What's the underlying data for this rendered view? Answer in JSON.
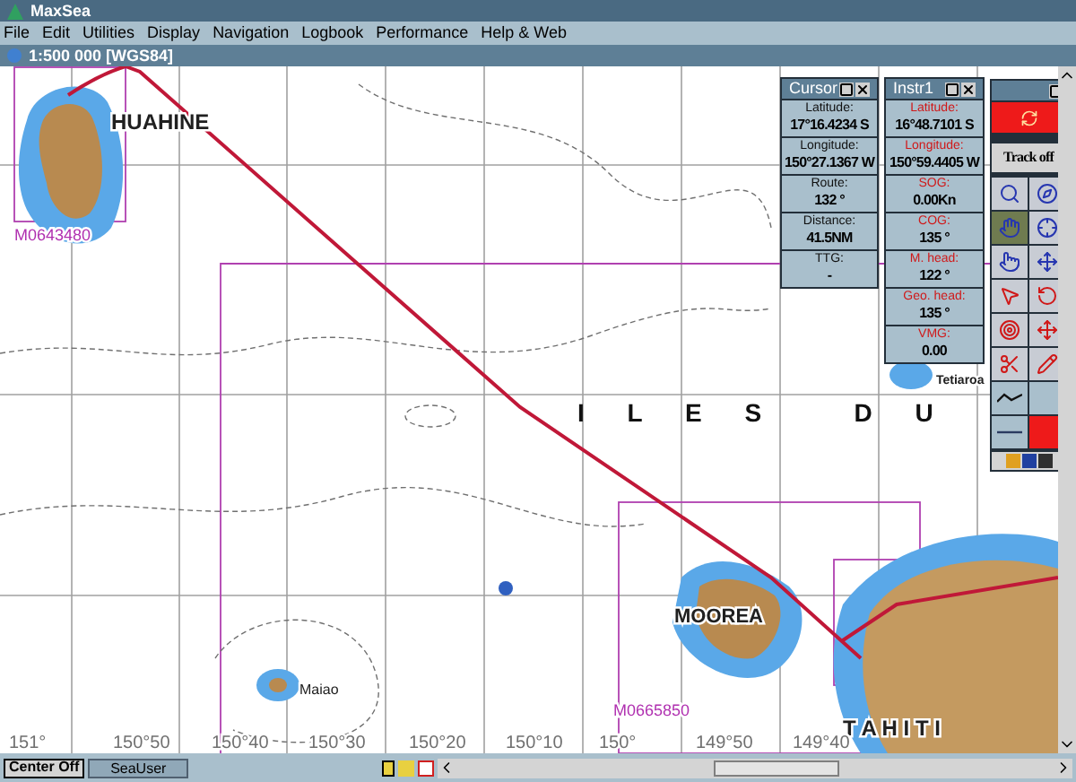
{
  "window": {
    "title": "MaxSea"
  },
  "menu": [
    "File",
    "Edit",
    "Utilities",
    "Display",
    "Navigation",
    "Logbook",
    "Performance",
    "Help & Web"
  ],
  "chart_window": {
    "title": "1:500 000 [WGS84]"
  },
  "map": {
    "islands": [
      "HUAHINE",
      "MOOREA",
      "T A H I T I",
      "Maiao",
      "Tetiaroa"
    ],
    "region": "I L E S   D U",
    "chart_codes": [
      "M0643480",
      "M0665850"
    ],
    "longitudes": [
      "151°",
      "150°50",
      "150°40",
      "150°30",
      "150°20",
      "150°10",
      "150°",
      "149°50",
      "149°40"
    ]
  },
  "cursor_panel": {
    "title": "Cursor",
    "fields": [
      {
        "label": "Latitude:",
        "value": "17°16.4234 S"
      },
      {
        "label": "Longitude:",
        "value": "150°27.1367 W"
      },
      {
        "label": "Route:",
        "value": "132 °"
      },
      {
        "label": "Distance:",
        "value": "41.5NM"
      },
      {
        "label": "TTG:",
        "value": "-"
      }
    ]
  },
  "instrument_panel": {
    "title": "Instr1",
    "fields": [
      {
        "label": "Latitude:",
        "value": "16°48.7101 S"
      },
      {
        "label": "Longitude:",
        "value": "150°59.4405 W"
      },
      {
        "label": "SOG:",
        "value": "0.00Kn"
      },
      {
        "label": "COG:",
        "value": "135 °"
      },
      {
        "label": "M. head:",
        "value": "122 °"
      },
      {
        "label": "Geo. head:",
        "value": "135 °"
      },
      {
        "label": "VMG:",
        "value": "0.00"
      }
    ]
  },
  "toolbar": {
    "track_button": "Track off"
  },
  "status_bar": {
    "center_button": "Center Off",
    "user": "SeaUser"
  }
}
